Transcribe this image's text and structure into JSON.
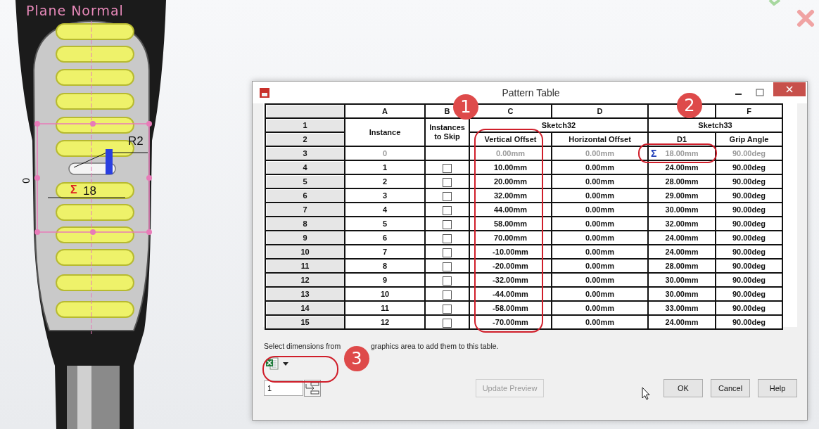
{
  "cad_view": {
    "view_label": "Plane Normal",
    "radius_label": "R2",
    "sum_mark": "Σ",
    "width_label": "18",
    "offset_label": "0"
  },
  "dialog": {
    "title": "Pattern Table",
    "column_letters": [
      "A",
      "B",
      "C",
      "D"
    ],
    "last_letter": "F",
    "header_numbers": [
      "1",
      "2"
    ],
    "instance_header": "Instance",
    "skip_header": "Instances to Skip",
    "groups": [
      {
        "name": "Sketch32",
        "columns": [
          "Vertical Offset",
          "Horizontal Offset"
        ]
      },
      {
        "name": "Sketch33",
        "columns": [
          "D1",
          "Grip Angle"
        ]
      }
    ],
    "rows": [
      {
        "number": "3",
        "instance": "0",
        "seed": true,
        "equation_mark": "Σ",
        "values": [
          "0.00mm",
          "0.00mm",
          "18.00mm",
          "90.00deg"
        ]
      },
      {
        "number": "4",
        "instance": "1",
        "seed": false,
        "checked": false,
        "values": [
          "10.00mm",
          "0.00mm",
          "24.00mm",
          "90.00deg"
        ]
      },
      {
        "number": "5",
        "instance": "2",
        "seed": false,
        "checked": false,
        "values": [
          "20.00mm",
          "0.00mm",
          "28.00mm",
          "90.00deg"
        ]
      },
      {
        "number": "6",
        "instance": "3",
        "seed": false,
        "checked": false,
        "values": [
          "32.00mm",
          "0.00mm",
          "29.00mm",
          "90.00deg"
        ]
      },
      {
        "number": "7",
        "instance": "4",
        "seed": false,
        "checked": false,
        "values": [
          "44.00mm",
          "0.00mm",
          "30.00mm",
          "90.00deg"
        ]
      },
      {
        "number": "8",
        "instance": "5",
        "seed": false,
        "checked": false,
        "values": [
          "58.00mm",
          "0.00mm",
          "32.00mm",
          "90.00deg"
        ]
      },
      {
        "number": "9",
        "instance": "6",
        "seed": false,
        "checked": false,
        "values": [
          "70.00mm",
          "0.00mm",
          "24.00mm",
          "90.00deg"
        ]
      },
      {
        "number": "10",
        "instance": "7",
        "seed": false,
        "checked": false,
        "values": [
          "-10.00mm",
          "0.00mm",
          "24.00mm",
          "90.00deg"
        ]
      },
      {
        "number": "11",
        "instance": "8",
        "seed": false,
        "checked": false,
        "values": [
          "-20.00mm",
          "0.00mm",
          "28.00mm",
          "90.00deg"
        ]
      },
      {
        "number": "12",
        "instance": "9",
        "seed": false,
        "checked": false,
        "values": [
          "-32.00mm",
          "0.00mm",
          "30.00mm",
          "90.00deg"
        ]
      },
      {
        "number": "13",
        "instance": "10",
        "seed": false,
        "checked": false,
        "values": [
          "-44.00mm",
          "0.00mm",
          "30.00mm",
          "90.00deg"
        ]
      },
      {
        "number": "14",
        "instance": "11",
        "seed": false,
        "checked": false,
        "values": [
          "-58.00mm",
          "0.00mm",
          "33.00mm",
          "90.00deg"
        ]
      },
      {
        "number": "15",
        "instance": "12",
        "seed": false,
        "checked": false,
        "values": [
          "-70.00mm",
          "0.00mm",
          "24.00mm",
          "90.00deg"
        ]
      }
    ],
    "hint_parts": [
      "Select dimensions from",
      "graphics area to add them to this table."
    ],
    "instance_count": "1",
    "buttons": [
      {
        "label": "Update Preview",
        "disabled": true
      },
      {
        "label": "OK",
        "disabled": false
      },
      {
        "label": "Cancel",
        "disabled": false
      },
      {
        "label": "Help",
        "disabled": false
      }
    ]
  },
  "callouts": [
    "1",
    "2",
    "3"
  ]
}
